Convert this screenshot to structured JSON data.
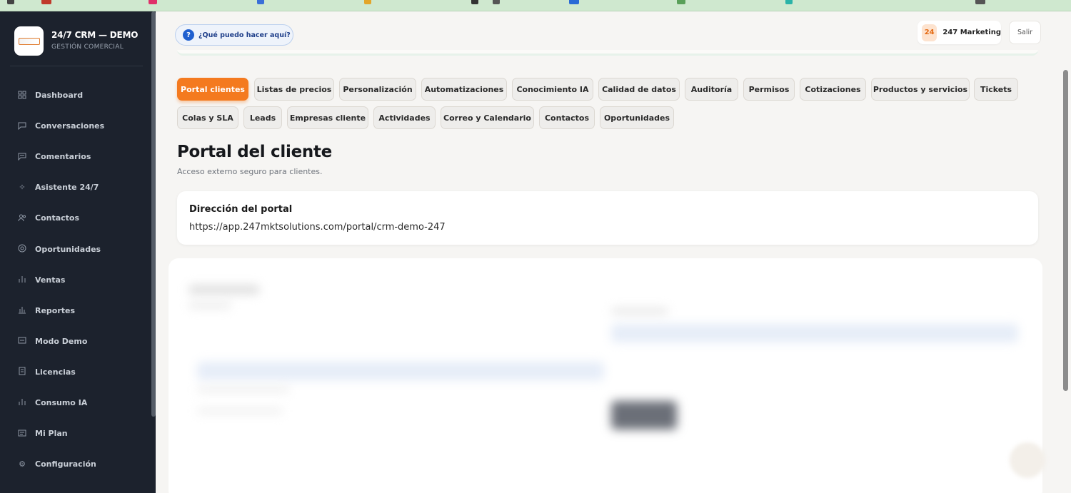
{
  "app": {
    "title": "24/7 CRM — DEMO",
    "subtitle": "GESTIÓN COMERCIAL"
  },
  "sidebar": {
    "items": [
      {
        "label": "Dashboard",
        "icon": "grid-icon"
      },
      {
        "label": "Conversaciones",
        "icon": "chat-icon"
      },
      {
        "label": "Comentarios",
        "icon": "comment-icon"
      },
      {
        "label": "Asistente 24/7",
        "icon": "sparkle-icon"
      },
      {
        "label": "Contactos",
        "icon": "users-icon"
      },
      {
        "label": "Oportunidades",
        "icon": "target-icon"
      },
      {
        "label": "Ventas",
        "icon": "bar-chart-icon"
      },
      {
        "label": "Reportes",
        "icon": "bar-chart-icon"
      },
      {
        "label": "Modo Demo",
        "icon": "monitor-icon"
      },
      {
        "label": "Licencias",
        "icon": "document-icon"
      },
      {
        "label": "Consumo IA",
        "icon": "bar-chart-icon"
      },
      {
        "label": "Mi Plan",
        "icon": "card-icon"
      },
      {
        "label": "Configuración",
        "icon": "gear-icon"
      }
    ]
  },
  "header": {
    "help_label": "¿Qué puedo hacer aquí?",
    "help_icon": "?",
    "user_initials": "24",
    "user_name": "247 Marketing",
    "logout_label": "Salir"
  },
  "tabs": [
    {
      "label": "Portal clientes",
      "active": true
    },
    {
      "label": "Listas de precios"
    },
    {
      "label": "Personalización"
    },
    {
      "label": "Automatizaciones"
    },
    {
      "label": "Conocimiento IA"
    },
    {
      "label": "Calidad de datos"
    },
    {
      "label": "Auditoría"
    },
    {
      "label": "Permisos"
    },
    {
      "label": "Cotizaciones"
    },
    {
      "label": "Productos y servicios"
    },
    {
      "label": "Tickets"
    },
    {
      "label": "Colas y SLA"
    },
    {
      "label": "Leads"
    },
    {
      "label": "Empresas cliente"
    },
    {
      "label": "Actividades"
    },
    {
      "label": "Correo y Calendario"
    },
    {
      "label": "Contactos"
    },
    {
      "label": "Oportunidades"
    }
  ],
  "page": {
    "title": "Portal del cliente",
    "subtitle": "Acceso externo seguro para clientes."
  },
  "portal_card": {
    "heading": "Dirección del portal",
    "url": "https://app.247mktsolutions.com/portal/crm-demo-247"
  },
  "colors": {
    "accent": "#f47a1f",
    "sidebar_bg": "#1c222d",
    "page_bg": "#f6f5f3",
    "help_blue": "#1f5fcf"
  }
}
